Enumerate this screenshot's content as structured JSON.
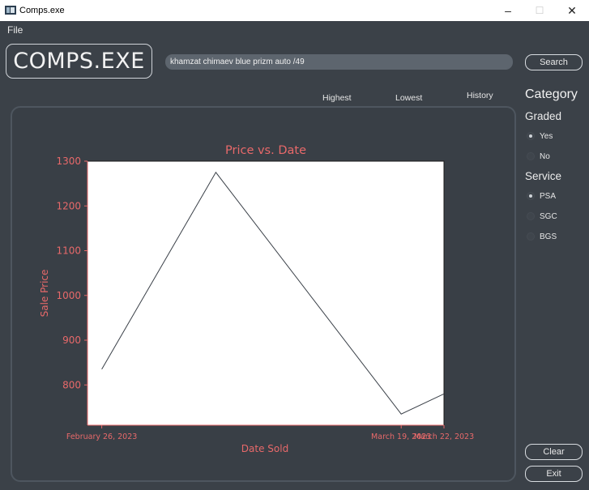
{
  "window": {
    "title": "Comps.exe",
    "minimize": "–",
    "maximize": "☐",
    "close": "✕"
  },
  "menu": {
    "file": "File"
  },
  "logo": "COMPS.EXE",
  "search": {
    "value": "khamzat chimaev blue prizm auto /49",
    "button": "Search"
  },
  "tabs": {
    "highest": "Highest",
    "lowest": "Lowest",
    "history": "History"
  },
  "sidebar": {
    "category": "Category",
    "graded": {
      "title": "Graded",
      "options": [
        {
          "label": "Yes",
          "selected": true
        },
        {
          "label": "No",
          "selected": false
        }
      ]
    },
    "service": {
      "title": "Service",
      "options": [
        {
          "label": "PSA",
          "selected": true
        },
        {
          "label": "SGC",
          "selected": false
        },
        {
          "label": "BGS",
          "selected": false
        }
      ]
    }
  },
  "buttons": {
    "clear": "Clear",
    "exit": "Exit"
  },
  "colors": {
    "background": "#3b4148",
    "chart_text": "#e8696a",
    "line": "#3a4048"
  },
  "chart_data": {
    "type": "line",
    "title": "Price vs. Date",
    "xlabel": "Date Sold",
    "ylabel": "Sale Price",
    "x": [
      "2023-02-26",
      "2023-03-06",
      "2023-03-19",
      "2023-03-22"
    ],
    "y": [
      835,
      1275,
      735,
      780
    ],
    "xticks": [
      "February 26, 2023",
      "March 19, 2023",
      "March 22, 2023"
    ],
    "yticks": [
      800,
      900,
      1000,
      1100,
      1200,
      1300
    ],
    "xlim": [
      "2023-02-25",
      "2023-03-22"
    ],
    "ylim": [
      710,
      1300
    ],
    "grid": false
  }
}
